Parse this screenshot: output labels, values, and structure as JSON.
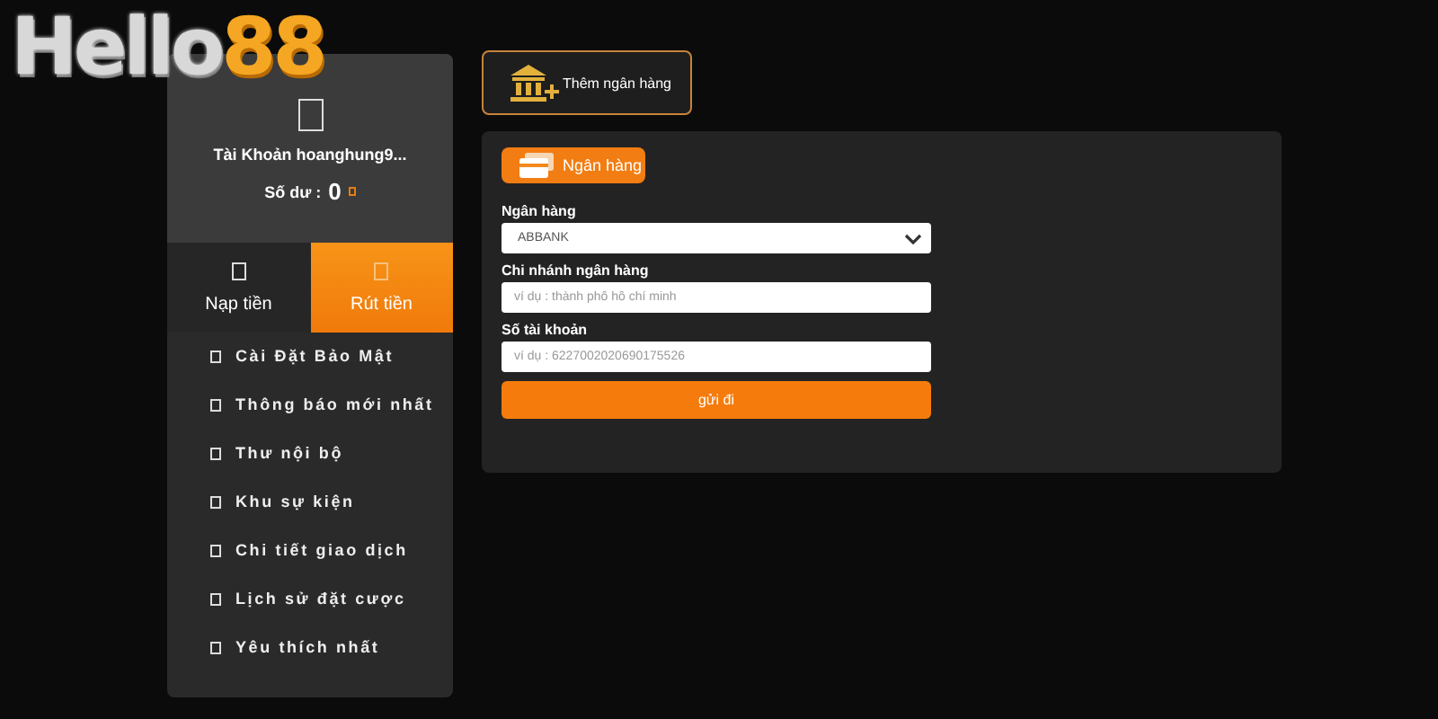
{
  "logo": {
    "text": "Hello",
    "accent": "88"
  },
  "account": {
    "name": "Tài Khoản hoanghung9...",
    "balance_label": "Số dư :",
    "balance": "0"
  },
  "tabs": [
    {
      "label": "Nạp tiền",
      "selected": false
    },
    {
      "label": "Rút tiền",
      "selected": true
    }
  ],
  "menu": [
    "Cài Đặt Bảo Mật",
    "Thông báo mới nhất",
    "Thư nội bộ",
    "Khu sự kiện",
    "Chi tiết giao dịch",
    "Lịch sử đặt cược",
    "Yêu thích nhất"
  ],
  "add_bank_button": "Thêm ngân hàng",
  "form": {
    "tab": "Ngân hàng",
    "fields": [
      {
        "kind": "select",
        "label": "Ngân hàng",
        "value": "ABBANK"
      },
      {
        "kind": "input",
        "label": "Chi nhánh ngân hàng",
        "placeholder": "ví dụ : thành phố hồ chí minh"
      },
      {
        "kind": "input",
        "label": "Số tài khoản",
        "placeholder": "ví dụ : 6227002020690175526"
      }
    ],
    "submit": "gửi đi"
  }
}
